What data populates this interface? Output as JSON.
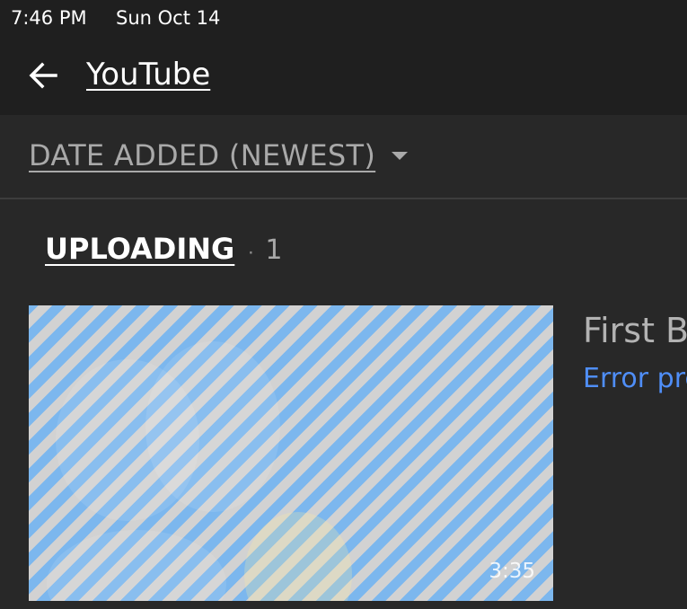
{
  "status_bar": {
    "time": "7:46 PM",
    "date": "Sun Oct 14"
  },
  "header": {
    "back_icon": "arrow-left-icon",
    "title": "YouTube"
  },
  "sort": {
    "label": "DATE ADDED (NEWEST)",
    "caret_icon": "caret-down-icon"
  },
  "section": {
    "title": "UPLOADING",
    "separator": "·",
    "count": "1"
  },
  "video": {
    "duration": "3:35",
    "title": "First B",
    "status": "Error pre"
  },
  "colors": {
    "background": "#282828",
    "header_background": "#1f1f1f",
    "accent_blue": "#4f8ef7",
    "stripe_blue": "#7cb7ee",
    "stripe_gray": "#d2d2d2"
  }
}
